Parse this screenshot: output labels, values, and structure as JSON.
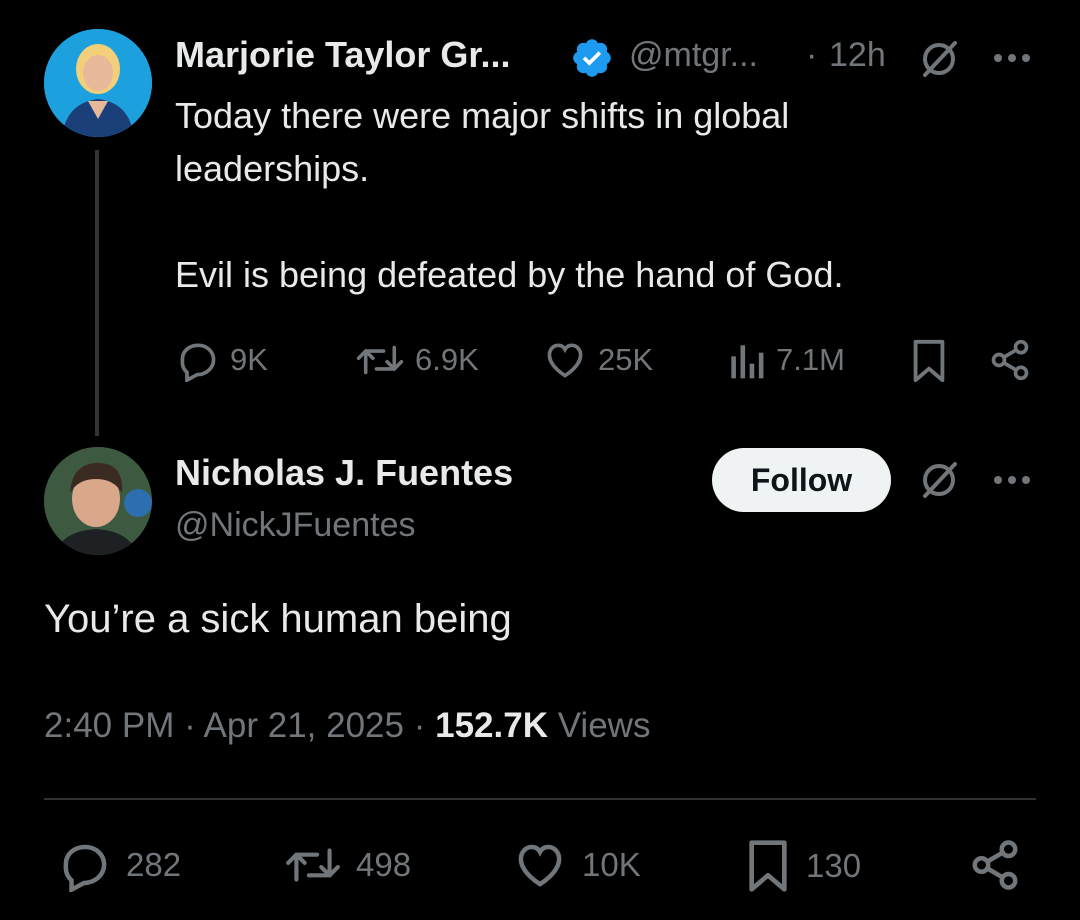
{
  "parent_tweet": {
    "author_name": "Marjorie Taylor Gr...",
    "handle": "@mtgr...",
    "separator": "·",
    "time_ago": "12h",
    "lines": [
      "Today there were major shifts in global",
      "leaderships."
    ],
    "line3": "Evil is being defeated by the hand of God.",
    "stats": {
      "replies": "9K",
      "reposts": "6.9K",
      "likes": "25K",
      "views": "7.1M"
    }
  },
  "main_tweet": {
    "author_name": "Nicholas J. Fuentes",
    "handle": "@NickJFuentes",
    "follow_label": "Follow",
    "text": "You’re a sick human being",
    "time": "2:40 PM",
    "sep1": "·",
    "date": "Apr 21, 2025",
    "sep2": "·",
    "views_count": "152.7K",
    "views_label": "Views",
    "stats": {
      "replies": "282",
      "reposts": "498",
      "likes": "10K",
      "bookmarks": "130"
    }
  },
  "colors": {
    "background": "#000000",
    "text": "#e7e9ea",
    "muted": "#71767b",
    "verified": "#1d9bf0",
    "follow_bg": "#eff3f4"
  },
  "icons": [
    "verified-badge-icon",
    "grok-icon",
    "more-icon",
    "reply-icon",
    "repost-icon",
    "like-icon",
    "views-icon",
    "bookmark-icon",
    "share-icon"
  ]
}
